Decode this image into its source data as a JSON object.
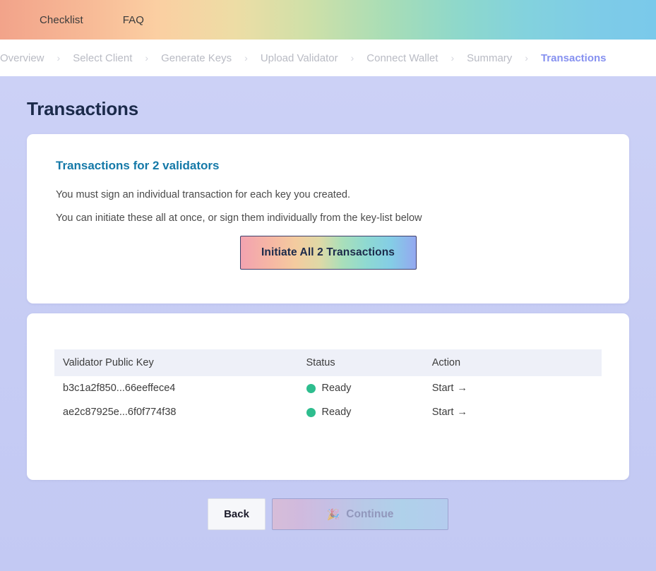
{
  "topbar": {
    "links": [
      {
        "label": "Checklist",
        "name": "checklist"
      },
      {
        "label": "FAQ",
        "name": "faq"
      }
    ]
  },
  "breadcrumb": {
    "separator": "›",
    "items": [
      {
        "label": "Overview",
        "active": false
      },
      {
        "label": "Select Client",
        "active": false
      },
      {
        "label": "Generate Keys",
        "active": false
      },
      {
        "label": "Upload Validator",
        "active": false
      },
      {
        "label": "Connect Wallet",
        "active": false
      },
      {
        "label": "Summary",
        "active": false
      },
      {
        "label": "Transactions",
        "active": true
      }
    ]
  },
  "page": {
    "title": "Transactions"
  },
  "info_card": {
    "heading": "Transactions for 2 validators",
    "line1": "You must sign an individual transaction for each key you created.",
    "line2": "You can initiate these all at once, or sign them individually from the key-list below",
    "initiate_button": "Initiate All 2 Transactions"
  },
  "table": {
    "columns": {
      "key": "Validator Public Key",
      "status": "Status",
      "action": "Action"
    },
    "rows": [
      {
        "key": "b3c1a2f850...66eeffece4",
        "status": "Ready",
        "status_color": "#2ebd8e",
        "action": "Start",
        "action_arrow": "→"
      },
      {
        "key": "ae2c87925e...6f0f774f38",
        "status": "Ready",
        "status_color": "#2ebd8e",
        "action": "Start",
        "action_arrow": "→"
      }
    ]
  },
  "footer": {
    "back": "Back",
    "continue": "Continue",
    "continue_emoji": "🎉"
  },
  "colors": {
    "accent_heading": "#1579a8",
    "breadcrumb_active": "#8691f0",
    "page_background": "#ccd1f6",
    "status_ready": "#2ebd8e",
    "title": "#1b2a4a"
  }
}
